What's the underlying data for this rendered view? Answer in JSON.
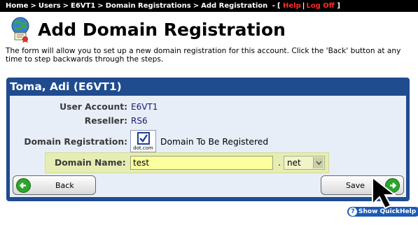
{
  "breadcrumb": {
    "items": [
      "Home",
      "Users",
      "E6VT1",
      "Domain Registrations",
      "Add Registration"
    ],
    "separator": ">",
    "dash": "-",
    "open_bracket": "[",
    "close_bracket": "]",
    "help_label": "Help",
    "pipe": "|",
    "logoff_label": "Log Off"
  },
  "page": {
    "title": "Add Domain Registration",
    "intro": "The form will allow you to set up a new domain registration for this account. Click the 'Back' button at any time to step backwards through the steps."
  },
  "panel": {
    "header": "Toma, Adi (E6VT1)",
    "user_account_label": "User Account:",
    "user_account_value": "E6VT1",
    "reseller_label": "Reseller:",
    "reseller_value": "RS6",
    "domain_registration_label": "Domain Registration:",
    "dotcom_badge": "dot.com",
    "domain_to_be_registered": "Domain To Be Registered",
    "domain_name_label": "Domain Name:",
    "domain_name_value": "test",
    "dot": ".",
    "tld_selected": "net"
  },
  "buttons": {
    "back_label": "Back",
    "save_label": "Save"
  },
  "quickhelp": {
    "label": "Show QuickHelp",
    "icon_glyph": "?"
  },
  "icons": [
    "globe-certificate-icon",
    "checkbox-icon",
    "back-arrow-icon",
    "forward-arrow-icon",
    "help-icon",
    "cursor-icon"
  ],
  "colors": {
    "topbar": "#000000",
    "panel": "#1f4b8f",
    "panel_body": "#e8eef8",
    "highlight": "#e6edb3",
    "input": "#fbff9e",
    "link_red": "#ff2a2a",
    "button_green": "#2aa62a"
  }
}
